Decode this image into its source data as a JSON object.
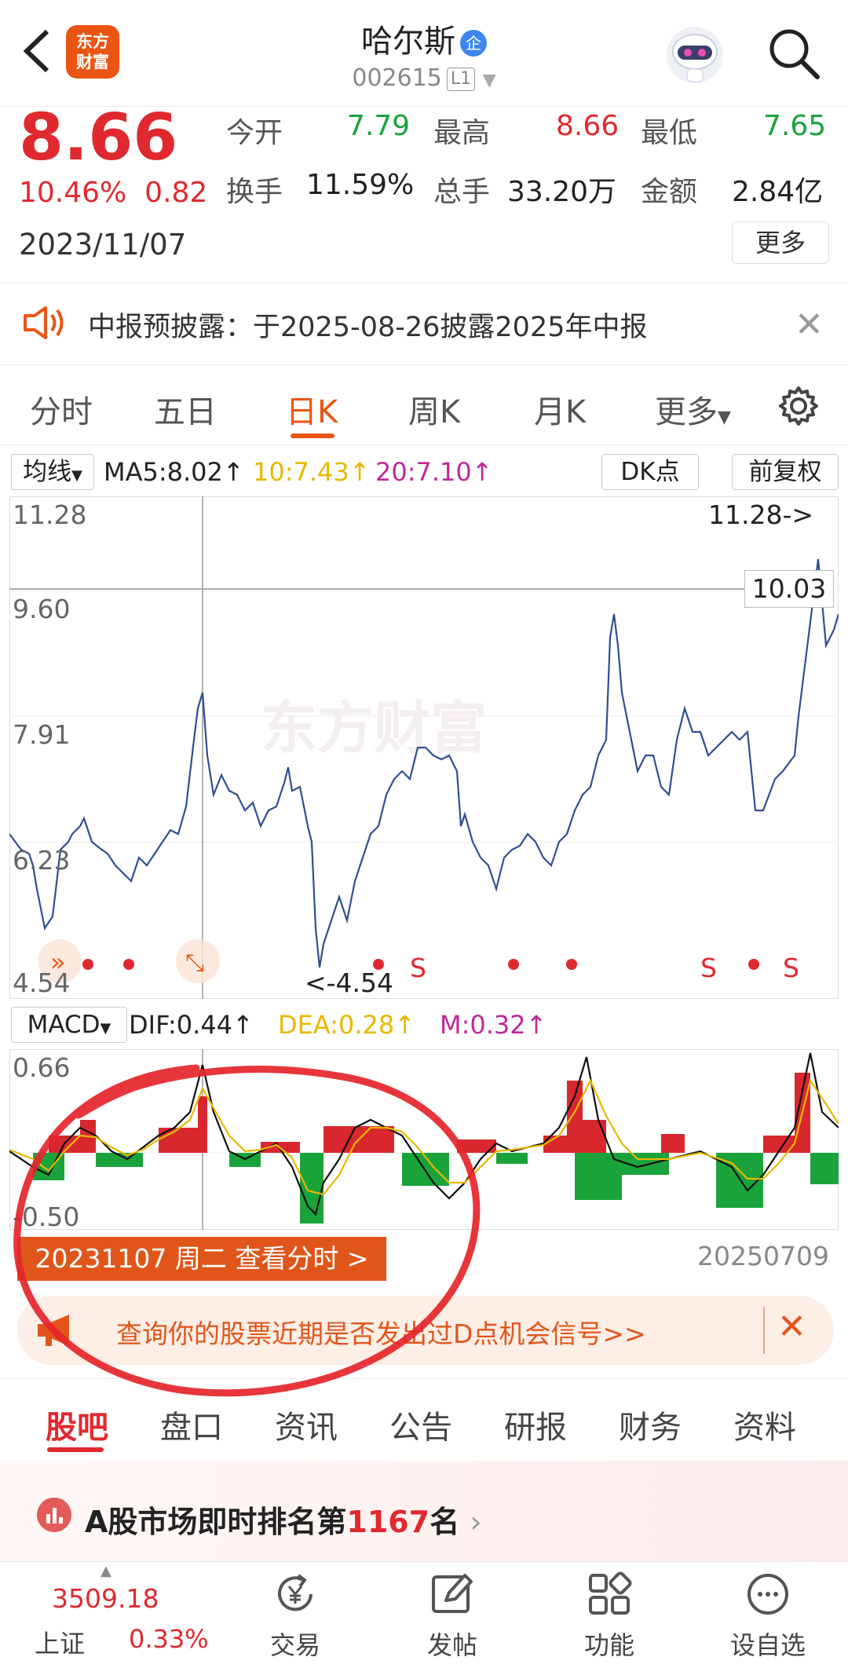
{
  "header": {
    "name": "哈尔斯",
    "badge": "企",
    "code": "002615",
    "level": "L1",
    "logo_line1": "东方",
    "logo_line2": "财富"
  },
  "quote": {
    "price": "8.66",
    "change_pct": "10.46%",
    "change": "0.82",
    "date": "2023/11/07",
    "open_label": "今开",
    "open": "7.79",
    "high_label": "最高",
    "high": "8.66",
    "low_label": "最低",
    "low": "7.65",
    "turnover_label": "换手",
    "turnover": "11.59%",
    "volume_label": "总手",
    "volume": "33.20万",
    "amount_label": "金额",
    "amount": "2.84亿",
    "more": "更多"
  },
  "notice": {
    "text": "中报预披露：于2025-08-26披露2025年中报"
  },
  "kline_tabs": [
    "分时",
    "五日",
    "日K",
    "周K",
    "月K",
    "更多"
  ],
  "ma_bar": {
    "selector": "均线",
    "ma5": "MA5:8.02",
    "ma10": "10:7.43",
    "ma20": "20:7.10",
    "dk": "DK点",
    "fq": "前复权"
  },
  "price_chart": {
    "y_labels": [
      "11.28",
      "9.60",
      "7.91",
      "6.23",
      "4.54"
    ],
    "max_marker": "11.28->",
    "min_marker": "<-4.54",
    "crosshair_value": "10.03",
    "watermark": "东方财富",
    "signal_s": "S"
  },
  "macd_bar": {
    "selector": "MACD",
    "dif": "DIF:0.44",
    "dea": "DEA:0.28",
    "m": "M:0.32",
    "y_top": "0.66",
    "y_bottom": "-0.50"
  },
  "date_bar": {
    "selected": "20231107 周二 查看分时 >",
    "end": "20250709"
  },
  "banner": {
    "text": "查询你的股票近期是否发出过D点机会信号>>"
  },
  "bottom_tabs": [
    "股吧",
    "盘口",
    "资讯",
    "公告",
    "研报",
    "财务",
    "资料"
  ],
  "rank": {
    "prefix": "A股市场即时排名第",
    "number": "1167",
    "suffix": "名"
  },
  "footer": {
    "index_value": "3509.18",
    "index_name": "上证",
    "index_change": "0.33%",
    "items": [
      "交易",
      "发帖",
      "功能",
      "设自选"
    ]
  },
  "colors": {
    "up": "#e0292e",
    "down": "#1aa33a",
    "accent": "#ea5513",
    "line": "#2f4f8f"
  }
}
